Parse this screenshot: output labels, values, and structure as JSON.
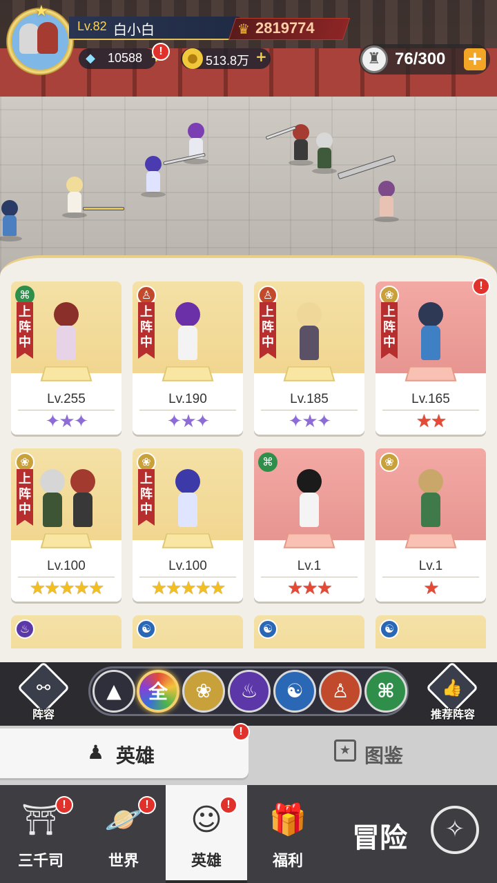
{
  "player": {
    "level": "Lv.82",
    "name": "白小白",
    "power": "2819774",
    "diamonds": "10588",
    "gold": "513.8万",
    "stamina": "76/300"
  },
  "heroes": [
    {
      "level": "Lv.255",
      "deployed": true,
      "deploy_label": "上阵中",
      "stars": "✦★✦",
      "star_style": "wing"
    },
    {
      "level": "Lv.190",
      "deployed": true,
      "deploy_label": "上阵中",
      "stars": "✦★✦",
      "star_style": "wing"
    },
    {
      "level": "Lv.185",
      "deployed": true,
      "deploy_label": "上阵中",
      "stars": "✦★✦",
      "star_style": "wing"
    },
    {
      "level": "Lv.165",
      "deployed": true,
      "deploy_label": "上阵中",
      "stars": "★★",
      "star_style": "red"
    },
    {
      "level": "Lv.100",
      "deployed": true,
      "deploy_label": "上阵中",
      "stars": "★★★★★",
      "star_style": "gold"
    },
    {
      "level": "Lv.100",
      "deployed": true,
      "deploy_label": "上阵中",
      "stars": "★★★★★",
      "star_style": "gold"
    },
    {
      "level": "Lv.1",
      "deployed": false,
      "deploy_label": "",
      "stars": "★★★",
      "star_style": "red"
    },
    {
      "level": "Lv.1",
      "deployed": false,
      "deploy_label": "",
      "stars": "★",
      "star_style": "red"
    }
  ],
  "filters": {
    "lineup_label": "阵容",
    "all_label": "全",
    "recommend_label": "推荐阵容"
  },
  "tabs": {
    "heroes": "英雄",
    "codex": "图鉴"
  },
  "nav": {
    "sanqiansi": "三千司",
    "world": "世界",
    "heroes": "英雄",
    "welfare": "福利",
    "adventure": "冒险"
  },
  "colors": {
    "accent_gold": "#f1bf22",
    "deploy_red": "#b62e2e",
    "badge_red": "#e0312a",
    "plus_orange": "#f3a526"
  }
}
